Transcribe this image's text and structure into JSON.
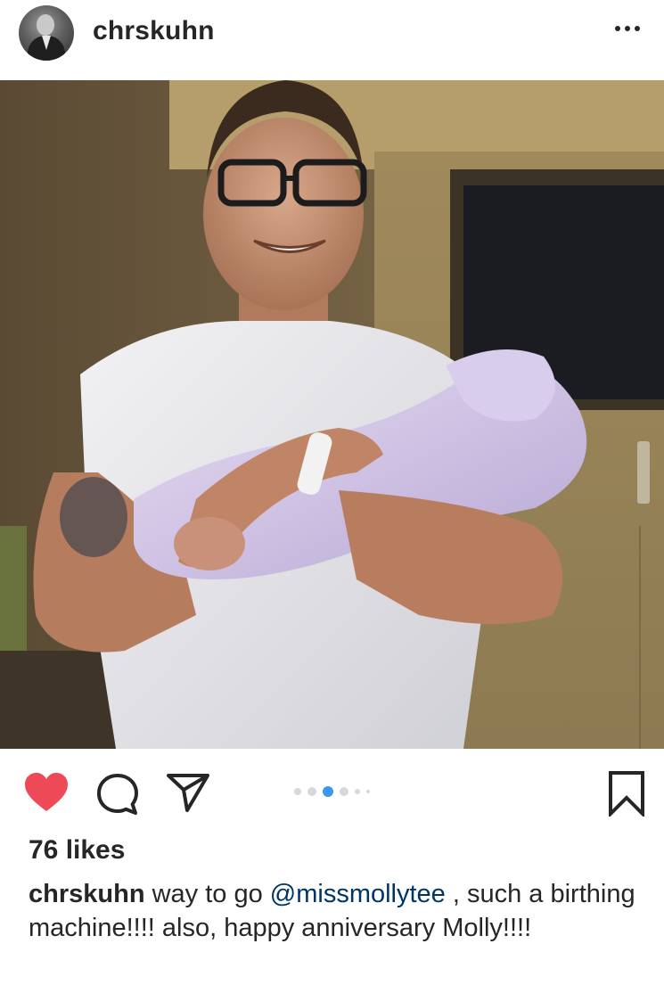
{
  "post": {
    "username": "chrskuhn",
    "avatar_icon": "profile-avatar",
    "more_icon": "more-options-icon",
    "photo_description_icon": "post-photo",
    "actions": {
      "like_icon": "heart-icon",
      "like_state": "liked",
      "like_color": "#ed4956",
      "comment_icon": "comment-icon",
      "share_icon": "paper-plane-icon",
      "save_icon": "bookmark-icon"
    },
    "carousel": {
      "total_dots": 6,
      "active_index": 2,
      "active_color": "#3897f0"
    },
    "likes_text": "76 likes",
    "caption": {
      "username": "chrskuhn",
      "text_before": " way to go ",
      "mention": "@missmollytee",
      "text_after": " , such a birthing machine!!!! also, happy anniversary Molly!!!!"
    }
  }
}
